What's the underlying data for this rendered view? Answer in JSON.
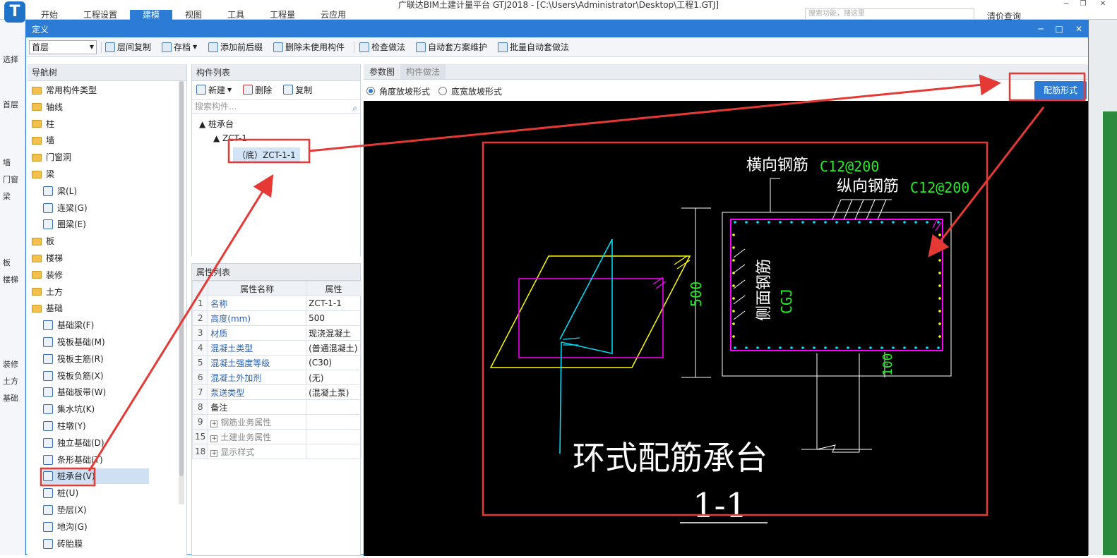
{
  "app": {
    "title": "广联达BIM土建计量平台 GTJ2018 - [C:\\Users\\Administrator\\Desktop\\工程1.GTJ]",
    "logo": "T",
    "tabs": [
      "开始",
      "工程设置",
      "建模",
      "视图",
      "工具",
      "工程量",
      "云应用"
    ],
    "search_placeholder": "搜索功能，搜这里",
    "right_label": "清价查询",
    "left_labels": [
      "选择",
      "首层",
      "墙",
      "门窗",
      "梁",
      "板",
      "楼梯",
      "装修",
      "土方",
      "基础"
    ]
  },
  "dialog": {
    "title": "定义",
    "floor": "首层",
    "toolbar": [
      "层间复制",
      "存档",
      "添加前后缀",
      "删除未使用构件",
      "检查做法",
      "自动套方案维护",
      "批量自动套做法"
    ]
  },
  "nav": {
    "header": "导航树",
    "items": [
      {
        "label": "常用构件类型",
        "level": 0
      },
      {
        "label": "轴线",
        "level": 0
      },
      {
        "label": "柱",
        "level": 0
      },
      {
        "label": "墙",
        "level": 0
      },
      {
        "label": "门窗洞",
        "level": 0
      },
      {
        "label": "梁",
        "level": 0
      },
      {
        "label": "梁(L)",
        "level": 1
      },
      {
        "label": "连梁(G)",
        "level": 1
      },
      {
        "label": "圈梁(E)",
        "level": 1
      },
      {
        "label": "板",
        "level": 0
      },
      {
        "label": "楼梯",
        "level": 0
      },
      {
        "label": "装修",
        "level": 0
      },
      {
        "label": "土方",
        "level": 0
      },
      {
        "label": "基础",
        "level": 0
      },
      {
        "label": "基础梁(F)",
        "level": 1
      },
      {
        "label": "筏板基础(M)",
        "level": 1
      },
      {
        "label": "筏板主筋(R)",
        "level": 1
      },
      {
        "label": "筏板负筋(X)",
        "level": 1
      },
      {
        "label": "基础板带(W)",
        "level": 1
      },
      {
        "label": "集水坑(K)",
        "level": 1
      },
      {
        "label": "柱墩(Y)",
        "level": 1
      },
      {
        "label": "独立基础(D)",
        "level": 1
      },
      {
        "label": "条形基础(T)",
        "level": 1
      },
      {
        "label": "桩承台(V)",
        "level": 1
      },
      {
        "label": "桩(U)",
        "level": 1
      },
      {
        "label": "垫层(X)",
        "level": 1
      },
      {
        "label": "地沟(G)",
        "level": 1
      },
      {
        "label": "砖胎膜",
        "level": 1
      }
    ]
  },
  "components": {
    "header": "构件列表",
    "new": "新建",
    "delete": "删除",
    "copy": "复制",
    "search_placeholder": "搜索构件...",
    "tree_root": "桩承台",
    "tree_child": "ZCT-1",
    "tree_leaf": "（底）ZCT-1-1"
  },
  "properties": {
    "header": "属性列表",
    "col_name": "属性名称",
    "col_value": "属性",
    "rows": [
      {
        "num": "1",
        "name": "名称",
        "value": "ZCT-1-1",
        "style": "link"
      },
      {
        "num": "2",
        "name": "高度(mm)",
        "value": "500",
        "style": "link"
      },
      {
        "num": "3",
        "name": "材质",
        "value": "现浇混凝土",
        "style": "link"
      },
      {
        "num": "4",
        "name": "混凝土类型",
        "value": "(普通混凝土)",
        "style": "link"
      },
      {
        "num": "5",
        "name": "混凝土强度等级",
        "value": "(C30)",
        "style": "link"
      },
      {
        "num": "6",
        "name": "混凝土外加剂",
        "value": "(无)",
        "style": "link"
      },
      {
        "num": "7",
        "name": "泵送类型",
        "value": "(混凝土泵)",
        "style": "link"
      },
      {
        "num": "8",
        "name": "备注",
        "value": "",
        "style": "plain"
      },
      {
        "num": "9",
        "name": "钢筋业务属性",
        "value": "",
        "style": "group"
      },
      {
        "num": "15",
        "name": "土建业务属性",
        "value": "",
        "style": "group"
      },
      {
        "num": "18",
        "name": "显示样式",
        "value": "",
        "style": "group"
      }
    ]
  },
  "drawing": {
    "tab_param": "参数图",
    "tab_method": "构件做法",
    "radio_angle": "角度放坡形式",
    "radio_width": "底宽放坡形式",
    "rebar_button": "配筋形式",
    "label_transverse": "横向钢筋",
    "transverse_value": "C12@200",
    "label_longitudinal": "纵向钢筋",
    "longitudinal_value": "C12@200",
    "label_side": "侧面钢筋",
    "side_value": "CGJ",
    "dim_height": "500",
    "dim_100": "100",
    "caption": "环式配筋承台",
    "section": "1-1"
  },
  "colors": {
    "accent": "#2c7cd6",
    "highlight_red": "#e53935",
    "cad_bg": "#000000",
    "cad_white": "#ffffff",
    "cad_green": "#22ee22",
    "cad_magenta": "#ff00ff",
    "cad_yellow": "#ffff00",
    "cad_cyan": "#00e5ff"
  }
}
